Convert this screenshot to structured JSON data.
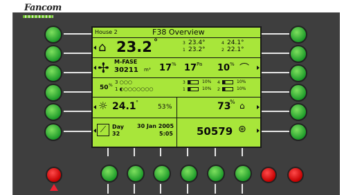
{
  "brand": {
    "logo": "Fancom"
  },
  "lcd": {
    "house": "House 2",
    "title": "F38 Overview",
    "temp": {
      "main": "23.2",
      "deg": "°",
      "s3": "3",
      "v3": "23.4°",
      "s4": "4",
      "v4": "24.1°",
      "s1": "1",
      "v1": "23.2°",
      "s2": "2",
      "v2": "22.1°"
    },
    "vent": {
      "mode": "M-FASE",
      "flow": "30211",
      "unit": "m³",
      "pct1": "17",
      "pct_sym": "%",
      "pa": "17",
      "pa_unit": "Pa",
      "pct2": "10",
      "pct2_sym": "%"
    },
    "status": {
      "pct": "50",
      "pct_sym": "%",
      "r1": "3 ○○○",
      "r2": "1 ◐○○○○○○○",
      "b3": "3",
      "b3v": "10%",
      "b4": "4",
      "b4v": "10%",
      "b1": "1",
      "b1v": "10%",
      "b2": "2",
      "b2v": "10%"
    },
    "outside": {
      "temp": "24.1",
      "deg": "°",
      "hum": "53",
      "hum_sym": "%",
      "rh": "73",
      "rh_sym": "%"
    },
    "date": {
      "label": "Day",
      "day": "32",
      "date": "30 Jan 2005",
      "time": "5:05",
      "counter": "50579"
    }
  },
  "colors": {
    "lcd": "#a8e63a",
    "button": "#1e9b2a",
    "stop": "#c40000"
  }
}
